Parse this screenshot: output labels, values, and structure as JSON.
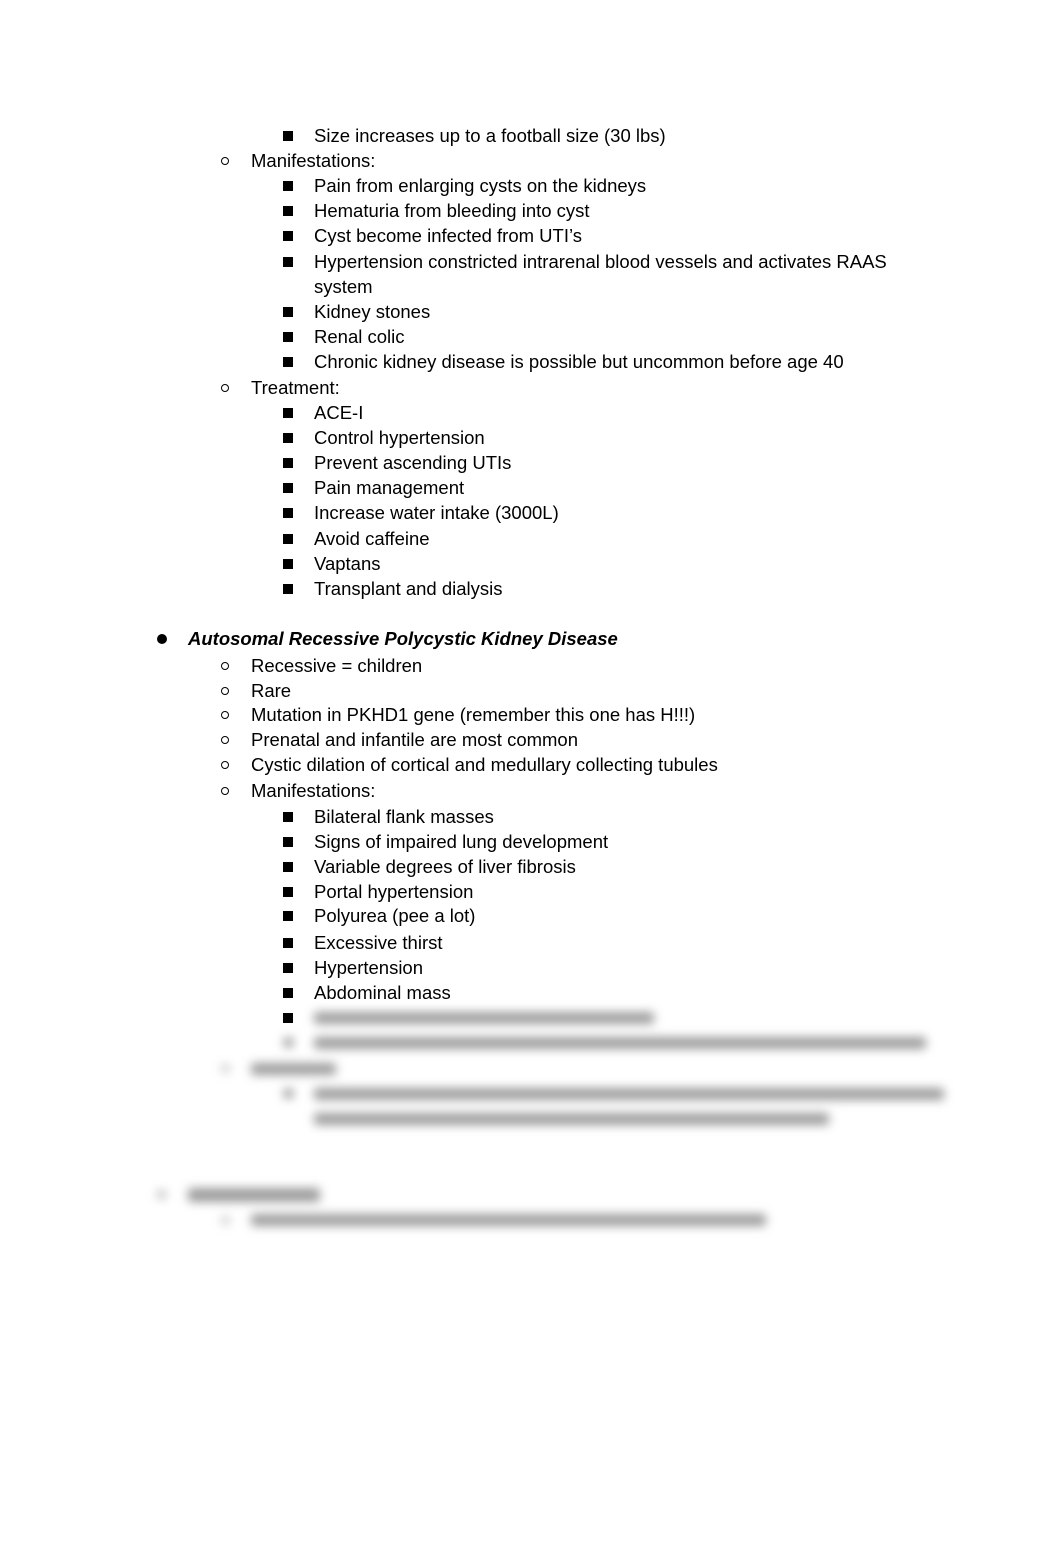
{
  "document": {
    "sections": [
      {
        "continued_items": [
          {
            "level": 3,
            "text": "Size increases up to a football size (30 lbs)"
          }
        ]
      },
      {
        "label": "Manifestations:",
        "items": [
          "Pain from enlarging cysts on the kidneys",
          "Hematuria from bleeding into cyst",
          "Cyst become infected from UTI’s",
          "Hypertension constricted intrarenal blood vessels and activates RAAS",
          "system",
          "Kidney stones",
          "Renal colic",
          "Chronic kidney disease is possible but uncommon before age 40"
        ]
      },
      {
        "label": "Treatment:",
        "items": [
          "ACE-I",
          "Control hypertension",
          "Prevent ascending UTIs",
          "Pain management",
          "Increase water intake (3000L)",
          "Avoid caffeine",
          "Vaptans",
          "Transplant and dialysis"
        ]
      }
    ],
    "arpkd": {
      "heading": "Autosomal Recessive Polycystic Kidney Disease",
      "points": [
        "Recessive = children",
        "Rare",
        "Mutation in PKHD1 gene (remember this one has H!!!)",
        "Prenatal and infantile are most common",
        "Cystic dilation of cortical and medullary collecting tubules"
      ],
      "manifestations_label": "Manifestations:",
      "manifestations": [
        "Bilateral flank masses",
        "Signs of impaired lung development",
        "Variable degrees of liver fibrosis",
        "Portal hypertension",
        "Polyurea (pee a lot)",
        "Excessive thirst",
        "Hypertension",
        "Abdominal mass"
      ]
    },
    "obscured_region": {
      "state": "blurred"
    }
  }
}
